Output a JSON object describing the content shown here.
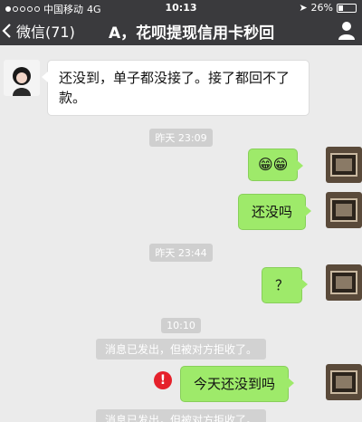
{
  "status_bar": {
    "carrier": "中国移动",
    "network": "4G",
    "time": "10:13",
    "battery": "26%",
    "battery_level": 0.26
  },
  "nav": {
    "back_label": "微信(71)",
    "title": "A，花呗提现信用卡秒回"
  },
  "messages": [
    {
      "from": "other",
      "text": "还没到，单子都没接了。接了都回不了款。"
    },
    {
      "type": "time",
      "text": "昨天 23:09"
    },
    {
      "from": "self",
      "text": "😁😁"
    },
    {
      "from": "self",
      "text": "还没吗"
    },
    {
      "type": "time",
      "text": "昨天 23:44"
    },
    {
      "from": "self",
      "text": "？"
    },
    {
      "type": "time",
      "text": "10:10"
    },
    {
      "type": "system",
      "text": "消息已发出，但被对方拒收了。"
    },
    {
      "from": "self",
      "text": "今天还没到吗",
      "failed": true
    },
    {
      "type": "system",
      "text": "消息已发出，但被对方拒收了。"
    }
  ],
  "colors": {
    "nav_bg": "#3a3a3d",
    "chat_bg": "#ebebeb",
    "self_bubble": "#9eea6a",
    "other_bubble": "#ffffff",
    "warning": "#e5212b"
  }
}
